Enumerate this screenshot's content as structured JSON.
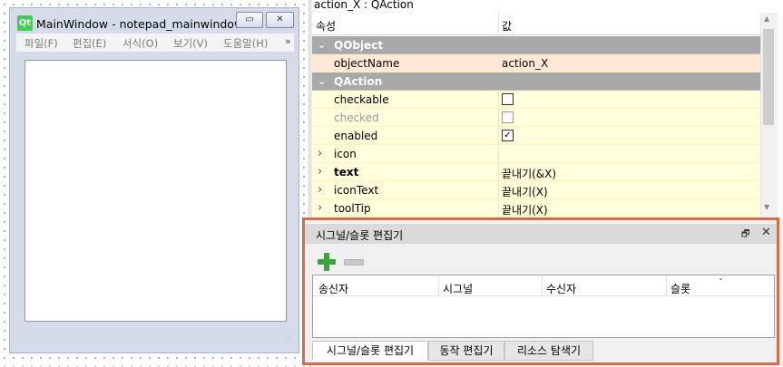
{
  "designer": {
    "logo_text": "Qt",
    "window_title": "MainWindow - notepad_mainwindow.ui*",
    "minimize_glyph": "▭",
    "close_glyph": "✕",
    "menus": [
      "파일(F)",
      "편집(E)",
      "서식(O)",
      "보기(V)",
      "도움말(H)"
    ],
    "menu_more": "»"
  },
  "property_editor": {
    "object_label": "action_X : QAction",
    "col_property": "속성",
    "col_value": "값",
    "rows": [
      {
        "type": "group",
        "label": "QObject"
      },
      {
        "type": "text",
        "label": "objectName",
        "value": "action_X"
      },
      {
        "type": "group",
        "label": "QAction"
      },
      {
        "type": "check",
        "label": "checkable",
        "checked": false
      },
      {
        "type": "check",
        "label": "checked",
        "checked": false,
        "disabled": true
      },
      {
        "type": "check",
        "label": "enabled",
        "checked": true
      },
      {
        "type": "expand",
        "label": "icon",
        "value": ""
      },
      {
        "type": "expand",
        "label": "text",
        "value": "끝내기(&X)",
        "bold": true
      },
      {
        "type": "expand",
        "label": "iconText",
        "value": "끝내기(X)"
      },
      {
        "type": "expand",
        "label": "toolTip",
        "value": "끝내기(X)"
      }
    ]
  },
  "signal_slot_editor": {
    "title": "시그널/슬롯 편집기",
    "float_glyph": "🗗",
    "close_glyph": "✕",
    "columns": [
      "송신자",
      "시그널",
      "수신자",
      "슬롯"
    ],
    "tabs": [
      "시그널/슬롯 편집기",
      "동작 편집기",
      "리소스 탐색기"
    ],
    "active_tab": 0
  },
  "colors": {
    "accent_border": "#d86b4d",
    "add_icon": "#3aa33a",
    "group_header": "#a8a8a8",
    "row_highlight": "#ffffdc"
  }
}
